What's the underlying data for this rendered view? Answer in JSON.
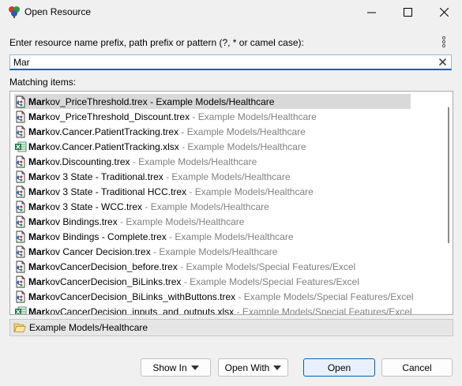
{
  "window": {
    "title": "Open Resource"
  },
  "prompt_label": "Enter resource name prefix, path prefix or pattern (?, * or camel case):",
  "search": {
    "value": "Mar"
  },
  "matching_label": "Matching items:",
  "items": [
    {
      "match": "Mar",
      "rest": "kov_PriceThreshold.trex",
      "sep": " - ",
      "path": "Example Models/Healthcare",
      "icon": "trex-file-icon",
      "selected": true
    },
    {
      "match": "Mar",
      "rest": "kov_PriceThreshold_Discount.trex",
      "sep": " - ",
      "path": "Example Models/Healthcare",
      "icon": "trex-file-icon"
    },
    {
      "match": "Mar",
      "rest": "kov.Cancer.PatientTracking.trex",
      "sep": " - ",
      "path": "Example Models/Healthcare",
      "icon": "trex-file-icon"
    },
    {
      "match": "Mar",
      "rest": "kov.Cancer.PatientTracking.xlsx",
      "sep": " - ",
      "path": "Example Models/Healthcare",
      "icon": "excel-file-icon"
    },
    {
      "match": "Mar",
      "rest": "kov.Discounting.trex",
      "sep": " - ",
      "path": "Example Models/Healthcare",
      "icon": "trex-file-icon"
    },
    {
      "match": "Mar",
      "rest": "kov 3 State - Traditional.trex",
      "sep": " - ",
      "path": "Example Models/Healthcare",
      "icon": "trex-file-icon"
    },
    {
      "match": "Mar",
      "rest": "kov 3 State - Traditional HCC.trex",
      "sep": " - ",
      "path": "Example Models/Healthcare",
      "icon": "trex-file-icon"
    },
    {
      "match": "Mar",
      "rest": "kov 3 State - WCC.trex",
      "sep": " - ",
      "path": "Example Models/Healthcare",
      "icon": "trex-file-icon"
    },
    {
      "match": "Mar",
      "rest": "kov Bindings.trex",
      "sep": " - ",
      "path": "Example Models/Healthcare",
      "icon": "trex-file-icon"
    },
    {
      "match": "Mar",
      "rest": "kov Bindings - Complete.trex",
      "sep": " - ",
      "path": "Example Models/Healthcare",
      "icon": "trex-file-icon"
    },
    {
      "match": "Mar",
      "rest": "kov Cancer Decision.trex",
      "sep": " - ",
      "path": "Example Models/Healthcare",
      "icon": "trex-file-icon"
    },
    {
      "match": "Mar",
      "rest": "kovCancerDecision_before.trex",
      "sep": " - ",
      "path": "Example Models/Special Features/Excel",
      "icon": "trex-file-icon"
    },
    {
      "match": "Mar",
      "rest": "kovCancerDecision_BiLinks.trex",
      "sep": " - ",
      "path": "Example Models/Special Features/Excel",
      "icon": "trex-file-icon"
    },
    {
      "match": "Mar",
      "rest": "kovCancerDecision_BiLinks_withButtons.trex",
      "sep": " - ",
      "path": "Example Models/Special Features/Excel",
      "icon": "trex-file-icon"
    },
    {
      "match": "Mar",
      "rest": "kovCancerDecision_inputs_and_outputs.xlsx",
      "sep": " - ",
      "path": "Example Models/Special Features/Excel",
      "icon": "excel-file-icon"
    }
  ],
  "status": {
    "folder_icon": "folder-open-icon",
    "text": "Example Models/Healthcare"
  },
  "buttons": {
    "show_in": "Show In",
    "open_with": "Open With",
    "open": "Open",
    "cancel": "Cancel"
  },
  "colors": {
    "selection": "#d9d9d9",
    "focus_border": "#0060c0",
    "path_text": "#808080"
  }
}
